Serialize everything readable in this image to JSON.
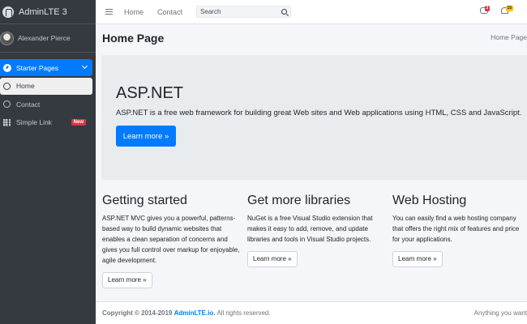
{
  "brand": {
    "title": "AdminLTE 3"
  },
  "user": {
    "name": "Alexander Pierce"
  },
  "sidebar": {
    "items": [
      {
        "label": "Starter Pages",
        "icon": "tachometer-icon"
      },
      {
        "label": "Home",
        "icon": "circle-icon"
      },
      {
        "label": "Contact",
        "icon": "circle-icon"
      },
      {
        "label": "Simple Link",
        "icon": "th-icon",
        "badge": "New"
      }
    ]
  },
  "topbar": {
    "links": [
      "Home",
      "Contact"
    ],
    "search_placeholder": "Search",
    "messages_count": "3",
    "notifications_count": "15"
  },
  "header": {
    "title": "Home Page",
    "breadcrumb": "Home Page"
  },
  "jumbotron": {
    "title": "ASP.NET",
    "lead": "ASP.NET is a free web framework for building great Web sites and Web applications using HTML, CSS and JavaScript.",
    "button": "Learn more »"
  },
  "columns": [
    {
      "title": "Getting started",
      "text": "ASP.NET MVC gives you a powerful, patterns-based way to build dynamic websites that enables a clean separation of concerns and gives you full control over markup for enjoyable, agile development.",
      "button": "Learn more »"
    },
    {
      "title": "Get more libraries",
      "text": "NuGet is a free Visual Studio extension that makes it easy to add, remove, and update libraries and tools in Visual Studio projects.",
      "button": "Learn more »"
    },
    {
      "title": "Web Hosting",
      "text": "You can easily find a web hosting company that offers the right mix of features and price for your applications.",
      "button": "Learn more »"
    }
  ],
  "footer": {
    "copyright_prefix": "Copyright © 2014-2019",
    "link": "AdminLTE.io.",
    "suffix": "All rights reserved.",
    "right": "Anything you want"
  },
  "colors": {
    "primary": "#007bff",
    "sidebar": "#343a40",
    "danger": "#dc3545",
    "warning": "#ffc107"
  }
}
